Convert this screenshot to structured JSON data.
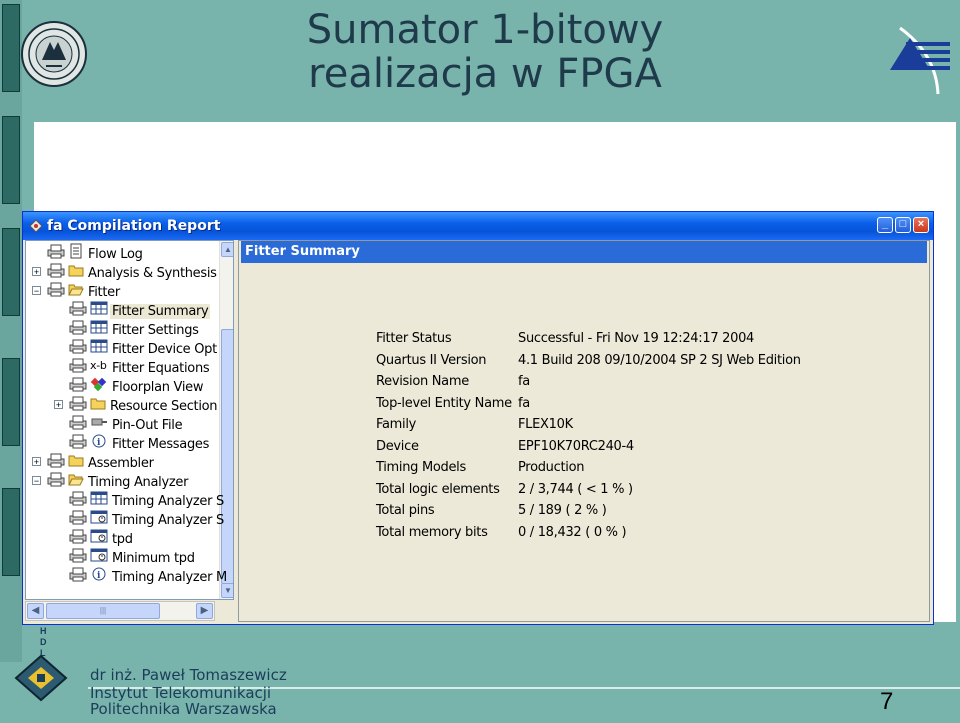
{
  "slide": {
    "title_line1": "Sumator 1-bitowy",
    "title_line2": "realizacja w FPGA",
    "page_number": "7",
    "hdl_letters": [
      "H",
      "D",
      "L"
    ],
    "footer": {
      "author": "dr inż. Paweł Tomaszewicz",
      "institute": "Instytut Telekomunikacji",
      "university": "Politechnika Warszawska"
    },
    "colors": {
      "background": "#78b4ac",
      "title": "#1f3a4a",
      "footer_text": "#1b3d59"
    }
  },
  "window": {
    "title": "fa Compilation Report",
    "buttons": [
      "minimize",
      "maximize",
      "close"
    ],
    "tree": [
      {
        "label": "Flow Log",
        "level": 0,
        "icon": "document-icon",
        "expander": ""
      },
      {
        "label": "Analysis & Synthesis",
        "level": 0,
        "icon": "folder-icon",
        "expander": "+"
      },
      {
        "label": "Fitter",
        "level": 0,
        "icon": "open-folder-icon",
        "expander": "-"
      },
      {
        "label": "Fitter Summary",
        "level": 1,
        "icon": "table-icon",
        "expander": "",
        "selected": true
      },
      {
        "label": "Fitter Settings",
        "level": 1,
        "icon": "table-icon",
        "expander": ""
      },
      {
        "label": "Fitter Device Opt",
        "level": 1,
        "icon": "table-icon",
        "expander": ""
      },
      {
        "label": "Fitter Equations",
        "level": 1,
        "icon": "equation-icon",
        "expander": ""
      },
      {
        "label": "Floorplan View",
        "level": 1,
        "icon": "floorplan-icon",
        "expander": ""
      },
      {
        "label": "Resource Section",
        "level": 1,
        "icon": "folder-icon",
        "expander": "+"
      },
      {
        "label": "Pin-Out File",
        "level": 1,
        "icon": "pin-icon",
        "expander": ""
      },
      {
        "label": "Fitter Messages",
        "level": 1,
        "icon": "info-icon",
        "expander": ""
      },
      {
        "label": "Assembler",
        "level": 0,
        "icon": "folder-icon",
        "expander": "+"
      },
      {
        "label": "Timing Analyzer",
        "level": 0,
        "icon": "open-folder-icon",
        "expander": "-"
      },
      {
        "label": "Timing Analyzer S",
        "level": 1,
        "icon": "table-icon",
        "expander": ""
      },
      {
        "label": "Timing Analyzer S",
        "level": 1,
        "icon": "chart-table-icon",
        "expander": ""
      },
      {
        "label": "tpd",
        "level": 1,
        "icon": "chart-table-icon",
        "expander": ""
      },
      {
        "label": "Minimum tpd",
        "level": 1,
        "icon": "chart-table-icon",
        "expander": ""
      },
      {
        "label": "Timing Analyzer M",
        "level": 1,
        "icon": "info-icon",
        "expander": ""
      }
    ],
    "summary_header": "Fitter Summary",
    "summary": [
      {
        "key": "Fitter Status",
        "value": "Successful - Fri Nov 19 12:24:17 2004"
      },
      {
        "key": "Quartus II Version",
        "value": "4.1 Build 208 09/10/2004 SP 2 SJ Web Edition"
      },
      {
        "key": "Revision Name",
        "value": "fa"
      },
      {
        "key": "Top-level Entity Name",
        "value": "fa"
      },
      {
        "key": "Family",
        "value": "FLEX10K"
      },
      {
        "key": "Device",
        "value": "EPF10K70RC240-4"
      },
      {
        "key": "Timing Models",
        "value": "Production"
      },
      {
        "key": "Total logic elements",
        "value": "2 / 3,744 ( < 1 % )"
      },
      {
        "key": "Total pins",
        "value": "5 / 189 ( 2 % )"
      },
      {
        "key": "Total memory bits",
        "value": "0 / 18,432 ( 0 % )"
      }
    ]
  }
}
